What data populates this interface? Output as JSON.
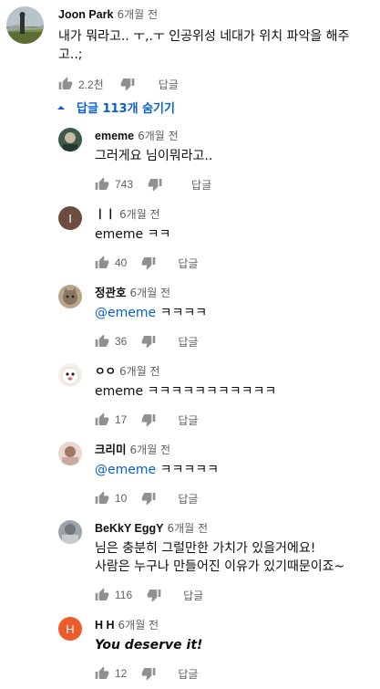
{
  "top_comment": {
    "author": "Joon Park",
    "time": "6개월 전",
    "text": "내가 뭐라고.. ㅜ,.ㅜ 인공위성 네대가 위치 파악을 해주고..;",
    "likes": "2.2천",
    "reply_label": "답글",
    "avatar_icon": "landscape-photo-avatar"
  },
  "replies_toggle": {
    "label": "답글 113개 숨기기",
    "color": "#065fd4",
    "icon": "chevron-up-icon"
  },
  "replies": [
    {
      "author": "ememe",
      "time": "6개월 전",
      "text": "그러게요 님이뭐라고..",
      "likes": "743",
      "reply_label": "답글",
      "avatar_icon": "photo-avatar"
    },
    {
      "author": "ㅣㅣ",
      "time": "6개월 전",
      "text": "ememe ㅋㅋ",
      "likes": "40",
      "reply_label": "답글",
      "avatar_letter": "I",
      "avatar_color": "#6d4c41"
    },
    {
      "author": "정관호",
      "time": "6개월 전",
      "mention": "@ememe",
      "text": " ㅋㅋㅋㅋ",
      "likes": "36",
      "reply_label": "답글",
      "avatar_icon": "cat-photo-avatar"
    },
    {
      "author": "ㅇㅇ",
      "time": "6개월 전",
      "text": "ememe ㅋㅋㅋㅋㅋㅋㅋㅋㅋㅋㅋ",
      "likes": "17",
      "reply_label": "답글",
      "avatar_icon": "dog-photo-avatar"
    },
    {
      "author": "크리미",
      "time": "6개월 전",
      "mention": "@ememe",
      "text": " ㅋㅋㅋㅋㅋ",
      "likes": "10",
      "reply_label": "답글",
      "avatar_icon": "photo-avatar"
    },
    {
      "author": "BeKkY EggY",
      "time": "6개월 전",
      "text_line1": "님은 충분히 그럴만한 가치가 있을거에요!",
      "text_line2": "사람은 누구나 만들어진 이유가 있기때문이죠~",
      "likes": "116",
      "reply_label": "답글",
      "avatar_icon": "photo-avatar"
    },
    {
      "author": "H H",
      "time": "6개월 전",
      "text": "You deserve it!",
      "likes": "12",
      "reply_label": "답글",
      "avatar_letter": "H",
      "avatar_color": "#ef5a2a"
    }
  ]
}
